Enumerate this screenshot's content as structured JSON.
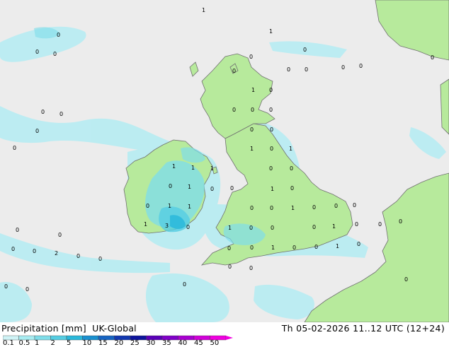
{
  "footer": {
    "title_precip": "Precipitation [mm]",
    "title_model": "UK-Global",
    "datetime": "Th 05-02-2026 11..12 UTC (12+24)"
  },
  "legend": {
    "ticks": [
      "0.1",
      "0.5",
      "1",
      "2",
      "5",
      "10",
      "15",
      "20",
      "25",
      "30",
      "35",
      "40",
      "45",
      "50"
    ],
    "colors": [
      "#cff3f6",
      "#a8ecf1",
      "#7fdde9",
      "#55cde2",
      "#2ab8da",
      "#1a90cf",
      "#1764c2",
      "#1238b0",
      "#0d149c",
      "#5a00b8",
      "#8000c8",
      "#a800d0",
      "#d000d8",
      "#f000e0"
    ]
  },
  "colors": {
    "sea": "#ececec",
    "land": "#b7ea9c",
    "coast": "#707070"
  },
  "map_labels": [
    {
      "id": "l1",
      "text": "1"
    },
    {
      "id": "l2",
      "text": "1"
    },
    {
      "id": "l3",
      "text": "0"
    },
    {
      "id": "l4",
      "text": "0"
    },
    {
      "id": "l5",
      "text": "0"
    },
    {
      "id": "l6",
      "text": "0"
    },
    {
      "id": "l7",
      "text": "0"
    },
    {
      "id": "l8",
      "text": "0"
    },
    {
      "id": "l9",
      "text": "0"
    },
    {
      "id": "l10",
      "text": "0"
    },
    {
      "id": "l11",
      "text": "0"
    },
    {
      "id": "l12",
      "text": "0"
    },
    {
      "id": "l13",
      "text": "0"
    },
    {
      "id": "l14",
      "text": "1"
    },
    {
      "id": "l15",
      "text": "0"
    },
    {
      "id": "l16",
      "text": "0"
    },
    {
      "id": "l17",
      "text": "0"
    },
    {
      "id": "l18",
      "text": "0"
    },
    {
      "id": "l19",
      "text": "0"
    },
    {
      "id": "l20",
      "text": "0"
    },
    {
      "id": "l21",
      "text": "0"
    },
    {
      "id": "l22",
      "text": "0"
    },
    {
      "id": "l23",
      "text": "0"
    },
    {
      "id": "l24",
      "text": "1"
    },
    {
      "id": "l25",
      "text": "1"
    },
    {
      "id": "l26",
      "text": "0"
    },
    {
      "id": "l27",
      "text": "1"
    },
    {
      "id": "l28",
      "text": "1"
    },
    {
      "id": "l29",
      "text": "0"
    },
    {
      "id": "l30",
      "text": "1"
    },
    {
      "id": "l31",
      "text": "1"
    },
    {
      "id": "l32",
      "text": "1"
    },
    {
      "id": "l33",
      "text": "3"
    },
    {
      "id": "l34",
      "text": "0"
    },
    {
      "id": "l35",
      "text": "0"
    },
    {
      "id": "l36",
      "text": "0"
    },
    {
      "id": "l37",
      "text": "1"
    },
    {
      "id": "l38",
      "text": "0"
    },
    {
      "id": "l39",
      "text": "0"
    },
    {
      "id": "l40",
      "text": "1"
    },
    {
      "id": "l41",
      "text": "0"
    },
    {
      "id": "l42",
      "text": "0"
    },
    {
      "id": "l43",
      "text": "0"
    },
    {
      "id": "l44",
      "text": "0"
    },
    {
      "id": "l45",
      "text": "1"
    },
    {
      "id": "l46",
      "text": "0"
    },
    {
      "id": "l47",
      "text": "0"
    },
    {
      "id": "l48",
      "text": "0"
    },
    {
      "id": "l49",
      "text": "1"
    },
    {
      "id": "l50",
      "text": "0"
    },
    {
      "id": "l51",
      "text": "0"
    },
    {
      "id": "l52",
      "text": "0"
    },
    {
      "id": "l53",
      "text": "0"
    },
    {
      "id": "l54",
      "text": "1"
    },
    {
      "id": "l55",
      "text": "0"
    },
    {
      "id": "l56",
      "text": "0"
    },
    {
      "id": "l57",
      "text": "1"
    },
    {
      "id": "l58",
      "text": "0"
    },
    {
      "id": "l59",
      "text": "0"
    },
    {
      "id": "l60",
      "text": "0"
    },
    {
      "id": "l61",
      "text": "0"
    },
    {
      "id": "l62",
      "text": "0"
    },
    {
      "id": "l63",
      "text": "0"
    },
    {
      "id": "l64",
      "text": "2"
    },
    {
      "id": "l65",
      "text": "0"
    },
    {
      "id": "l66",
      "text": "0"
    },
    {
      "id": "l67",
      "text": "0"
    },
    {
      "id": "l68",
      "text": "1"
    },
    {
      "id": "l69",
      "text": "0"
    },
    {
      "id": "l70",
      "text": "0"
    },
    {
      "id": "l71",
      "text": "1"
    },
    {
      "id": "l72",
      "text": "0"
    },
    {
      "id": "l73",
      "text": "0"
    },
    {
      "id": "l74",
      "text": "0"
    },
    {
      "id": "l75",
      "text": "0"
    },
    {
      "id": "l76",
      "text": "0"
    },
    {
      "id": "l77",
      "text": "0"
    },
    {
      "id": "l78",
      "text": "0"
    }
  ]
}
